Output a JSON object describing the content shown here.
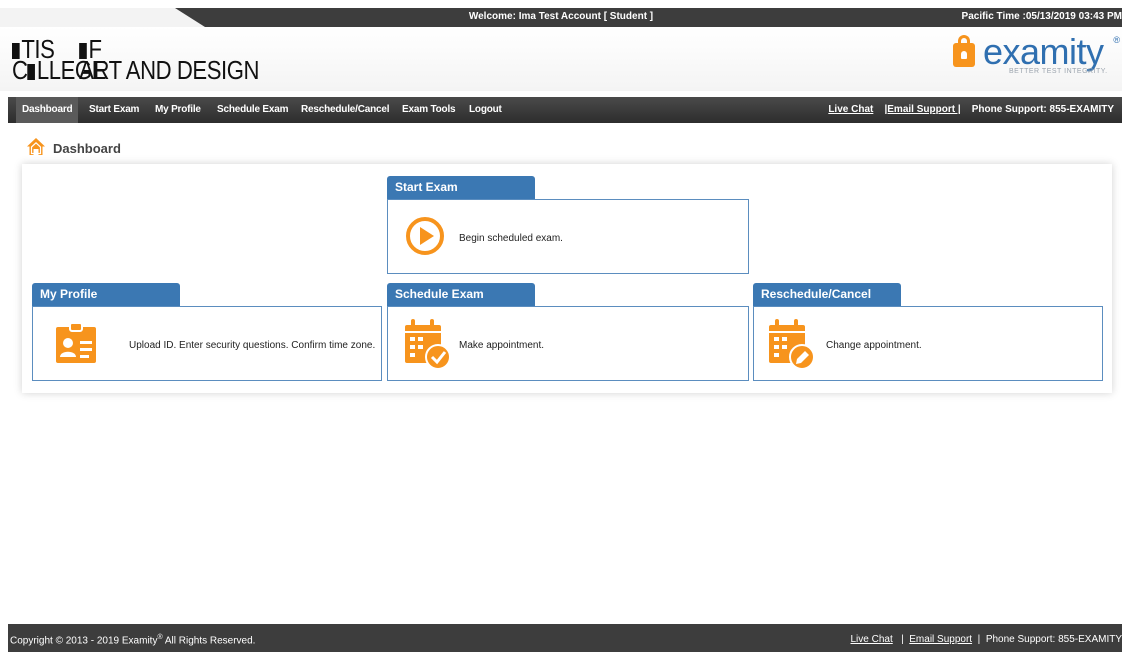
{
  "topbar": {
    "welcome": "Welcome: Ima Test Account [ Student ]",
    "time": "Pacific Time :05/13/2019 03:43 PM"
  },
  "logos": {
    "school_line1": "TIS",
    "school_line1b": "F",
    "school_line2a": "C",
    "school_line2b": "LLEGE",
    "school_line2c": "ART AND DESIGN",
    "brand": "examity",
    "brand_reg": "®",
    "brand_tagline": "BETTER TEST INTEGRITY."
  },
  "nav": {
    "items": [
      {
        "label": "Dashboard"
      },
      {
        "label": "Start Exam"
      },
      {
        "label": "My Profile"
      },
      {
        "label": "Schedule Exam"
      },
      {
        "label": "Reschedule/Cancel"
      },
      {
        "label": "Exam Tools"
      },
      {
        "label": "Logout"
      }
    ],
    "live_chat": "Live Chat",
    "email_support": "|Email Support |",
    "phone_support": "Phone Support: 855-EXAMITY"
  },
  "page": {
    "title": "Dashboard"
  },
  "cards": {
    "start_exam": {
      "title": "Start Exam",
      "desc": "Begin scheduled exam."
    },
    "my_profile": {
      "title": "My Profile",
      "desc": "Upload ID. Enter security questions. Confirm time zone."
    },
    "schedule_exam": {
      "title": "Schedule Exam",
      "desc": "Make appointment."
    },
    "reschedule": {
      "title": "Reschedule/Cancel",
      "desc": "Change appointment."
    }
  },
  "footer": {
    "copyright": "Copyright © 2013 - 2019 Examity",
    "reg": "®",
    "rights": "All Rights Reserved.",
    "live_chat": "Live Chat",
    "sep1": "|",
    "email_support": "Email Support",
    "sep2": "|",
    "phone_support": "Phone Support: 855-EXAMITY"
  },
  "colors": {
    "accent_orange": "#f7941d",
    "card_blue": "#3b78b3",
    "brand_blue": "#2f6fb0",
    "bar_dark": "#3d3d3d"
  }
}
